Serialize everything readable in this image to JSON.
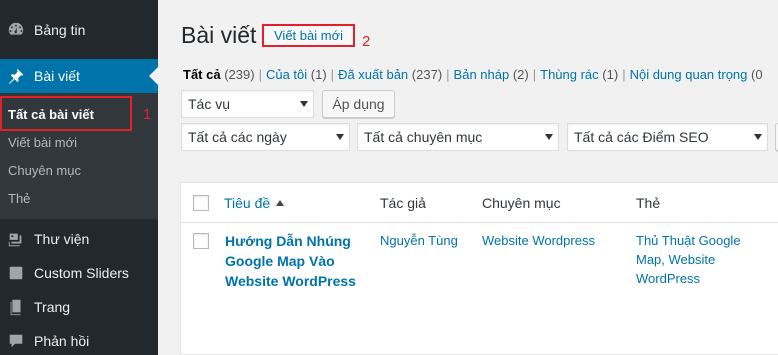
{
  "sidebar": {
    "items": [
      {
        "label": "Bảng tin",
        "icon": "dashboard-icon"
      },
      {
        "label": "Bài viết",
        "icon": "pin-icon"
      },
      {
        "label": "Thư viện",
        "icon": "media-icon"
      },
      {
        "label": "Custom Sliders",
        "icon": "slider-icon"
      },
      {
        "label": "Trang",
        "icon": "page-icon"
      },
      {
        "label": "Phản hồi",
        "icon": "comment-icon"
      }
    ],
    "submenu": [
      "Tất cả bài viết",
      "Viết bài mới",
      "Chuyên mục",
      "Thẻ"
    ]
  },
  "annotations": {
    "one": "1",
    "two": "2",
    "color": "#e0202a"
  },
  "header": {
    "title": "Bài viết",
    "add_new": "Viết bài mới"
  },
  "filters": {
    "links": [
      {
        "label": "Tất cả",
        "count": "(239)"
      },
      {
        "label": "Của tôi",
        "count": "(1)"
      },
      {
        "label": "Đã xuất bản",
        "count": "(237)"
      },
      {
        "label": "Bản nháp",
        "count": "(2)"
      },
      {
        "label": "Thùng rác",
        "count": "(1)"
      },
      {
        "label": "Nội dung quan trọng",
        "count": "(0"
      }
    ]
  },
  "bulk": {
    "action_select": "Tác vụ",
    "apply": "Áp dụng"
  },
  "filter_selects": {
    "dates": "Tất cả các ngày",
    "categories": "Tất cả chuyên mục",
    "seo": "Tất cả các Điểm SEO"
  },
  "table": {
    "headers": {
      "title": "Tiêu đề",
      "author": "Tác giả",
      "category": "Chuyên mục",
      "tags": "Thẻ"
    },
    "rows": [
      {
        "title_lines": [
          "Hướng Dẫn Nhúng",
          "Google Map Vào",
          "Website WordPress"
        ],
        "author": "Nguyễn Tùng",
        "category": "Website Wordpress",
        "tags_lines": [
          "Thủ Thuật Google",
          "Map, Website",
          "WordPress"
        ]
      }
    ]
  },
  "colors": {
    "sidebar_bg": "#23282d",
    "active": "#0073aa",
    "link": "#0073aa"
  }
}
